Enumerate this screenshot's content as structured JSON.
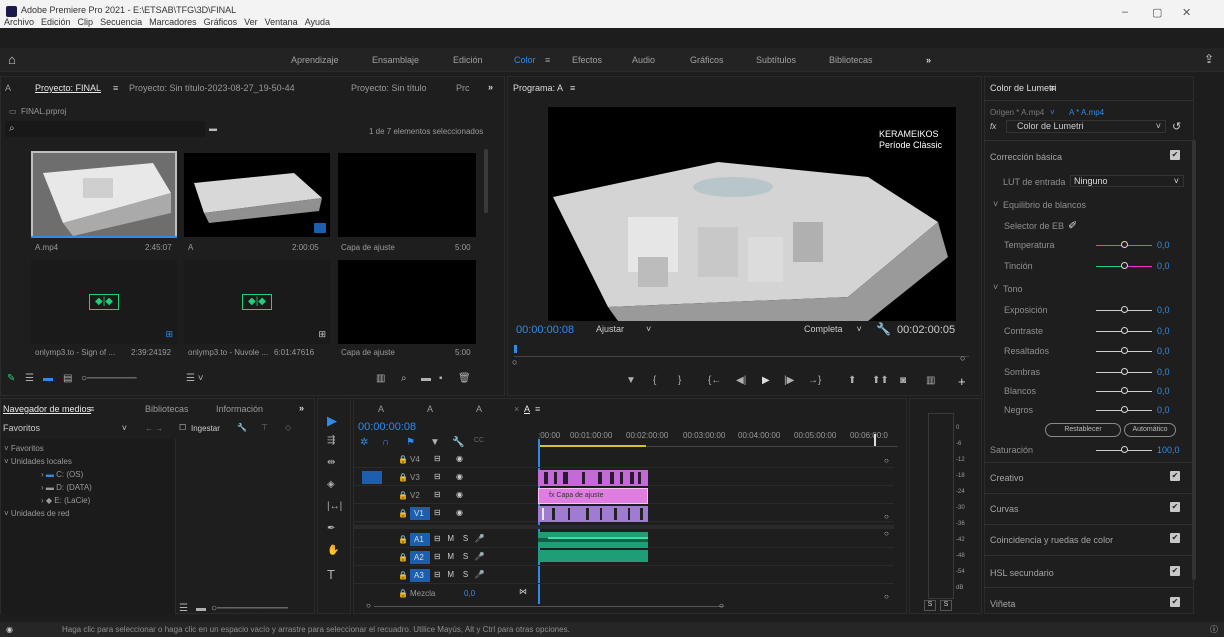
{
  "window": {
    "title": "Adobe Premiere Pro 2021 - E:\\ETSAB\\TFG\\3D\\FINAL",
    "minimize": "–",
    "restore": "▢",
    "close": "✕"
  },
  "menu": [
    "Archivo",
    "Edición",
    "Clip",
    "Secuencia",
    "Marcadores",
    "Gráficos",
    "Ver",
    "Ventana",
    "Ayuda"
  ],
  "workspaces": [
    "Aprendizaje",
    "Ensamblaje",
    "Edición",
    "Color",
    "Efectos",
    "Audio",
    "Gráficos",
    "Subtítulos",
    "Bibliotecas"
  ],
  "active_workspace": "Color",
  "project": {
    "tabs": [
      "A",
      "Proyecto: FINAL",
      "Proyecto: Sin título-2023-08-27_19-50-44",
      "Proyecto: Sin título",
      "Prc"
    ],
    "file": "FINAL.prproj",
    "selection_info": "1 de 7 elementos seleccionados",
    "items": [
      {
        "name": "A.mp4",
        "dur": "2:45:07"
      },
      {
        "name": "A",
        "dur": "2:00:05"
      },
      {
        "name": "Capa de ajuste",
        "dur": "5:00"
      },
      {
        "name": "onlymp3.to - Sign of ...",
        "dur": "2:39:24192"
      },
      {
        "name": "onlymp3.to - Nuvole ...",
        "dur": "6:01:47616"
      },
      {
        "name": "Capa de ajuste",
        "dur": "5:00"
      }
    ],
    "thumb_overlay": "KERAMEIKOS\nPeríode Clàssic"
  },
  "program": {
    "title": "Programa: A",
    "overlay_line1": "KERAMEIKOS",
    "overlay_line2": "Període Clàssic",
    "timecode": "00:00:00:08",
    "fit": "Ajustar",
    "quality": "Completa",
    "duration": "00:02:00:05"
  },
  "media": {
    "tabs": [
      "Navegador de medios",
      "Bibliotecas",
      "Información"
    ],
    "filter": "Favoritos",
    "ingest": "Ingestar",
    "tree": [
      "Favoritos",
      "Unidades locales",
      "C: (OS)",
      "D: (DATA)",
      "E: (LaCie)",
      "Unidades de red"
    ]
  },
  "timeline": {
    "tabs": [
      "A",
      "A",
      "A",
      "A"
    ],
    "timecode": "00:00:00:08",
    "ruler": [
      ":00:00",
      "00:01:00:00",
      "00:02:00:00",
      "00:03:00:00",
      "00:04:00:00",
      "00:05:00:00",
      "00:06:00:0"
    ],
    "tracks_video": [
      "V4",
      "V3",
      "V2",
      "V1"
    ],
    "tracks_audio": [
      "A1",
      "A2",
      "A3"
    ],
    "mix": "Mezcla",
    "mix_val": "0,0",
    "adj_clip": "Capa de ajuste",
    "meter_scale": [
      "0",
      "-6",
      "-12",
      "-18",
      "-24",
      "-30",
      "-36",
      "-42",
      "-48",
      "-54",
      "dB"
    ],
    "solo": [
      "S",
      "S"
    ]
  },
  "lumetri": {
    "title": "Color de Lumetri",
    "source": "Origen * A.mp4",
    "target": "A * A.mp4",
    "effect": "Color de Lumetri",
    "sections": {
      "basic": "Corrección básica",
      "lut_label": "LUT de entrada",
      "lut_value": "Ninguno",
      "wb": "Equilibrio de blancos",
      "wb_selector": "Selector de EB",
      "tone": "Tono",
      "reset": "Restablecer",
      "auto": "Automático",
      "creative": "Creativo",
      "curves": "Curvas",
      "wheels": "Coincidencia y ruedas de color",
      "hsl": "HSL secundario",
      "vignette": "Viñeta"
    },
    "sliders": [
      {
        "label": "Temperatura",
        "value": "0,0",
        "color": "#3d8bff"
      },
      {
        "label": "Tinción",
        "value": "0,0",
        "color": "#ff2bd0"
      },
      {
        "label": "Exposición",
        "value": "0,0"
      },
      {
        "label": "Contraste",
        "value": "0,0"
      },
      {
        "label": "Resaltados",
        "value": "0,0"
      },
      {
        "label": "Sombras",
        "value": "0,0"
      },
      {
        "label": "Blancos",
        "value": "0,0"
      },
      {
        "label": "Negros",
        "value": "0,0"
      },
      {
        "label": "Saturación",
        "value": "100,0"
      }
    ]
  },
  "status": "Haga clic para seleccionar o haga clic en un espacio vacío y arrastre para seleccionar el recuadro. Utilice Mayús, Alt y Ctrl para otras opciones."
}
